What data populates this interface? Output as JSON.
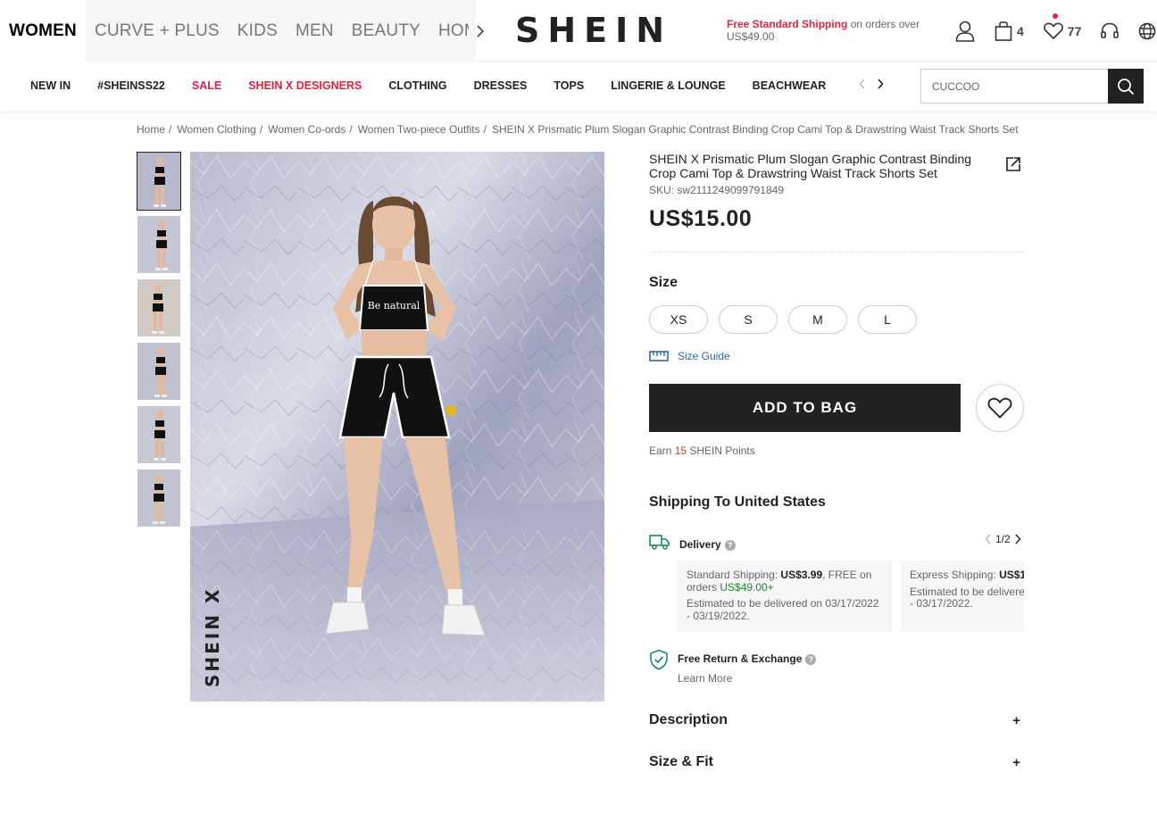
{
  "header": {
    "categories": [
      "WOMEN",
      "CURVE + PLUS",
      "KIDS",
      "MEN",
      "BEAUTY",
      "HOM"
    ],
    "logo": "SHEIN",
    "promo_highlight": "Free Standard Shipping",
    "promo_rest": " on orders over US$49.00",
    "bag_count": "4",
    "wishlist_count": "77"
  },
  "subnav": {
    "items": [
      "NEW IN",
      "#SHEINSS22",
      "SALE",
      "SHEIN X DESIGNERS",
      "CLOTHING",
      "DRESSES",
      "TOPS",
      "LINGERIE & LOUNGE",
      "BEACHWEAR"
    ],
    "search_value": "CUCCOO"
  },
  "breadcrumb": [
    "Home",
    "Women Clothing",
    "Women Co-ords",
    "Women Two-piece Outfits",
    "SHEIN X Prismatic Plum Slogan Graphic Contrast Binding Crop Cami Top & Drawstring Waist Track Shorts Set"
  ],
  "product": {
    "title": "SHEIN X Prismatic Plum Slogan Graphic Contrast Binding Crop Cami Top & Drawstring Waist Track Shorts Set",
    "sku": "SKU: sw2111249099791849",
    "price": "US$15.00",
    "size_heading": "Size",
    "sizes": [
      "XS",
      "S",
      "M",
      "L"
    ],
    "size_guide": "Size Guide",
    "add_to_bag": "ADD TO BAG",
    "points_prefix": "Earn ",
    "points_value": "15",
    "points_suffix": " SHEIN Points",
    "image_watermark": "SHEIN X",
    "tshirt_text": "Be natural"
  },
  "shipping": {
    "heading": "Shipping To United States",
    "delivery_label": "Delivery",
    "pager": "1/2",
    "standard": {
      "label": "Standard Shipping: ",
      "price": "US$3.99",
      "free": ", FREE on orders ",
      "threshold": "US$49.00+",
      "estimate": "Estimated to be delivered on 03/17/2022 - 03/19/2022."
    },
    "express": {
      "label": "Express Shipping: ",
      "price": "US$1",
      "estimate": "Estimated to be delivere - 03/17/2022."
    },
    "return_label": "Free Return & Exchange",
    "learn_more": "Learn More"
  },
  "accordion": {
    "description": "Description",
    "size_fit": "Size & Fit",
    "plus": "+"
  },
  "colors": {
    "accent_red": "#e4223f",
    "button_dark": "#222222",
    "link_blue": "#2d68a8",
    "green": "#1a8a2e"
  }
}
